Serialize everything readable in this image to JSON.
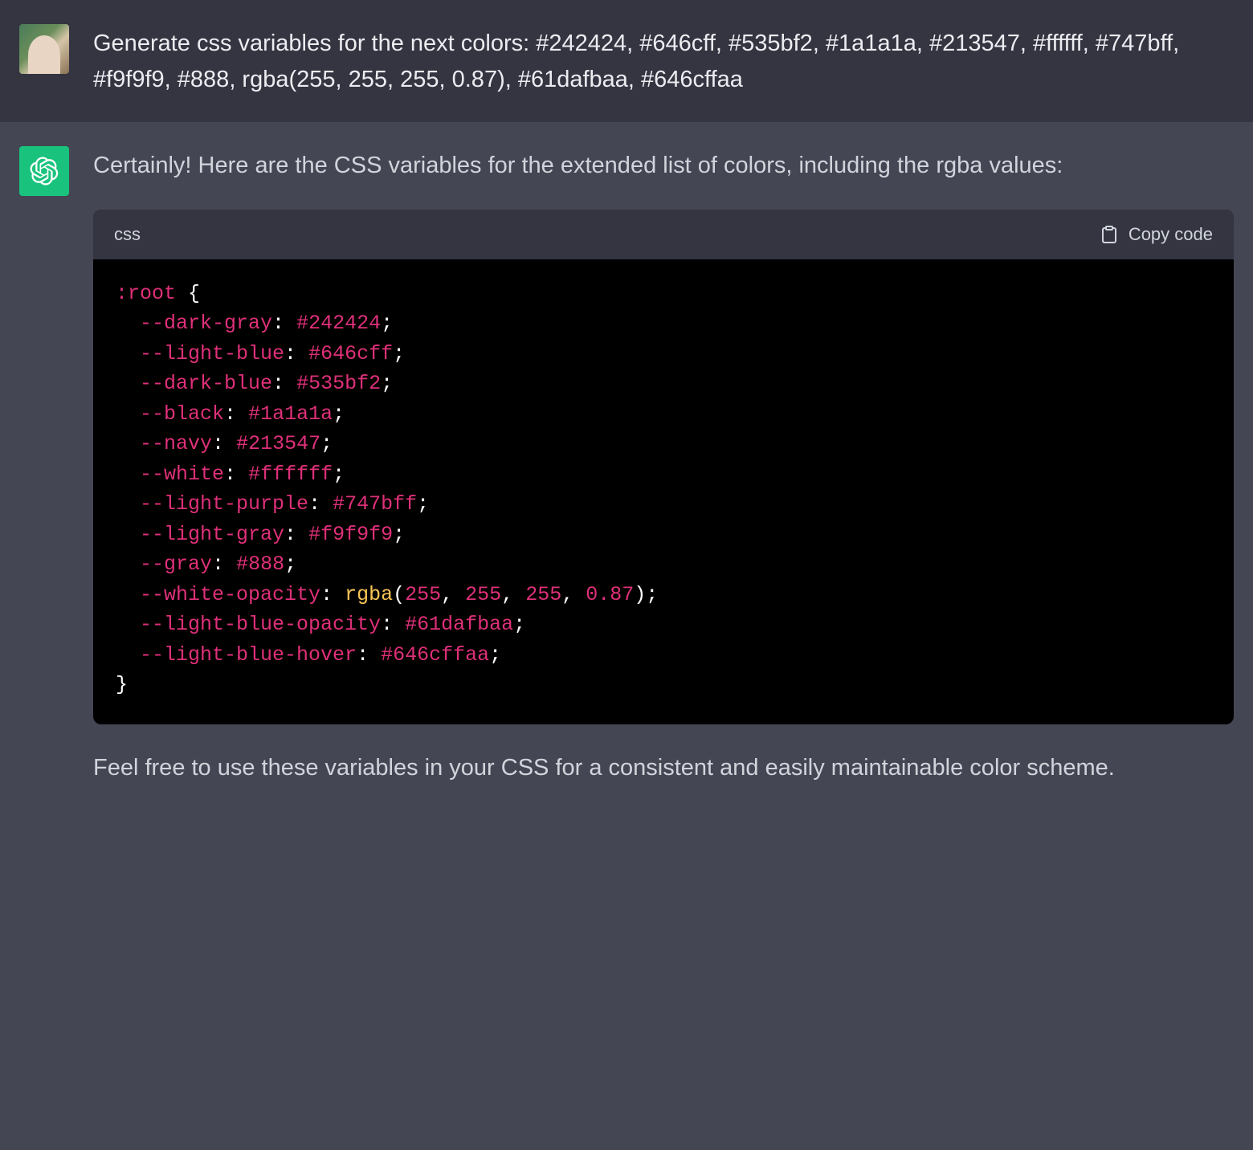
{
  "user": {
    "prompt": "Generate css variables for the next colors: #242424, #646cff, #535bf2, #1a1a1a, #213547, #ffffff, #747bff, #f9f9f9, #888, rgba(255, 255, 255, 0.87), #61dafbaa, #646cffaa"
  },
  "assistant": {
    "intro": "Certainly! Here are the CSS variables for the extended list of colors, including the rgba values:",
    "outro": "Feel free to use these variables in your CSS for a consistent and easily maintainable color scheme.",
    "code": {
      "language": "css",
      "copy_label": "Copy code",
      "selector": ":root",
      "entries": [
        {
          "name": "--dark-gray",
          "value": "#242424",
          "type": "hex"
        },
        {
          "name": "--light-blue",
          "value": "#646cff",
          "type": "hex"
        },
        {
          "name": "--dark-blue",
          "value": "#535bf2",
          "type": "hex"
        },
        {
          "name": "--black",
          "value": "#1a1a1a",
          "type": "hex"
        },
        {
          "name": "--navy",
          "value": "#213547",
          "type": "hex"
        },
        {
          "name": "--white",
          "value": "#ffffff",
          "type": "hex"
        },
        {
          "name": "--light-purple",
          "value": "#747bff",
          "type": "hex"
        },
        {
          "name": "--light-gray",
          "value": "#f9f9f9",
          "type": "hex"
        },
        {
          "name": "--gray",
          "value": "#888",
          "type": "hex"
        },
        {
          "name": "--white-opacity",
          "value": "rgba(255, 255, 255, 0.87)",
          "type": "rgba",
          "func": "rgba",
          "args": [
            "255",
            "255",
            "255",
            "0.87"
          ]
        },
        {
          "name": "--light-blue-opacity",
          "value": "#61dafbaa",
          "type": "hex"
        },
        {
          "name": "--light-blue-hover",
          "value": "#646cffaa",
          "type": "hex"
        }
      ]
    }
  }
}
